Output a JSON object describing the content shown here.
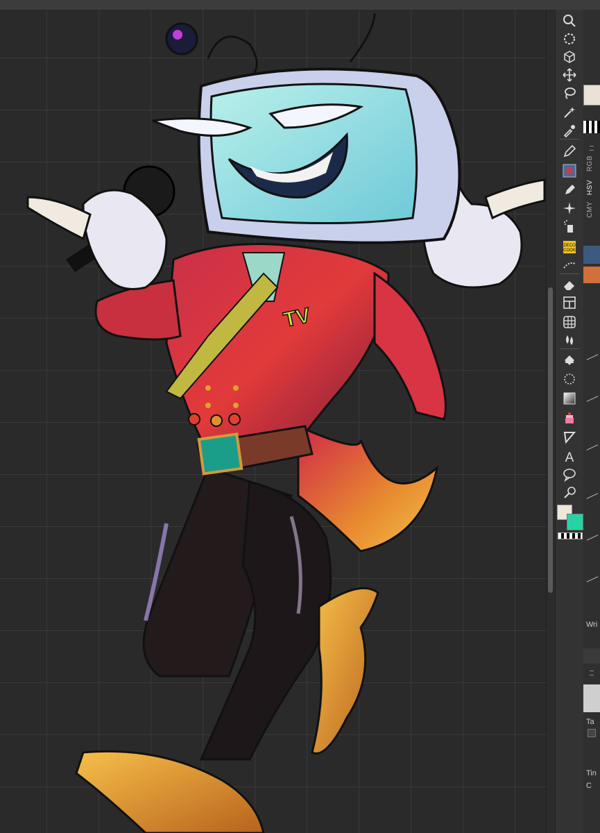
{
  "tools": [
    {
      "name": "zoom-tool-icon",
      "glyph": "search"
    },
    {
      "name": "rotate-view-icon",
      "glyph": "rotate"
    },
    {
      "name": "object-select-icon",
      "glyph": "cube"
    },
    {
      "name": "move-layer-icon",
      "glyph": "move"
    },
    {
      "name": "lasso-select-icon",
      "glyph": "lasso"
    },
    {
      "name": "magic-wand-icon",
      "glyph": "wand"
    },
    {
      "name": "eyedropper-icon",
      "glyph": "dropper"
    },
    {
      "name": "pen-tool-icon",
      "glyph": "pen"
    },
    {
      "name": "brush-preset-thumbnail",
      "glyph": "thumb"
    },
    {
      "name": "marker-tool-icon",
      "glyph": "marker"
    },
    {
      "name": "sparkle-brush-icon",
      "glyph": "sparkle"
    },
    {
      "name": "airbrush-icon",
      "glyph": "spray"
    },
    {
      "name": "decoration-tool-icon",
      "glyph": "deco"
    },
    {
      "name": "blend-tool-icon",
      "glyph": "blend"
    },
    {
      "name": "eraser-icon",
      "glyph": "eraser"
    },
    {
      "name": "frame-border-icon",
      "glyph": "frame"
    },
    {
      "name": "ruler-tool-icon",
      "glyph": "grid"
    },
    {
      "name": "blend-drops-icon",
      "glyph": "drops"
    },
    {
      "name": "fill-bucket-icon",
      "glyph": "bucket"
    },
    {
      "name": "ellipse-select-icon",
      "glyph": "circle"
    },
    {
      "name": "gradient-tool-icon",
      "glyph": "gradient"
    },
    {
      "name": "cake-tool-icon",
      "glyph": "cake"
    },
    {
      "name": "figure-tool-icon",
      "glyph": "triangle"
    },
    {
      "name": "text-tool-icon",
      "glyph": "A"
    },
    {
      "name": "balloon-tool-icon",
      "glyph": "balloon"
    },
    {
      "name": "correct-line-icon",
      "glyph": "correct"
    }
  ],
  "text_tool_label": "A",
  "deco_label": "DECO\nCOOK",
  "colors": {
    "main_color": "#efe7d9",
    "sub_color": "#27d3a6",
    "panel_bg": "#2f2f2f",
    "toolbar_bg": "#333333",
    "canvas_bg": "#2a2a2a",
    "grid_line": "#3a3a3a"
  },
  "right_panel": {
    "tabs": [
      "RGB",
      "HSV",
      "CMY"
    ],
    "labels": [
      "Wri",
      "Ta",
      "Tin",
      "C"
    ]
  }
}
